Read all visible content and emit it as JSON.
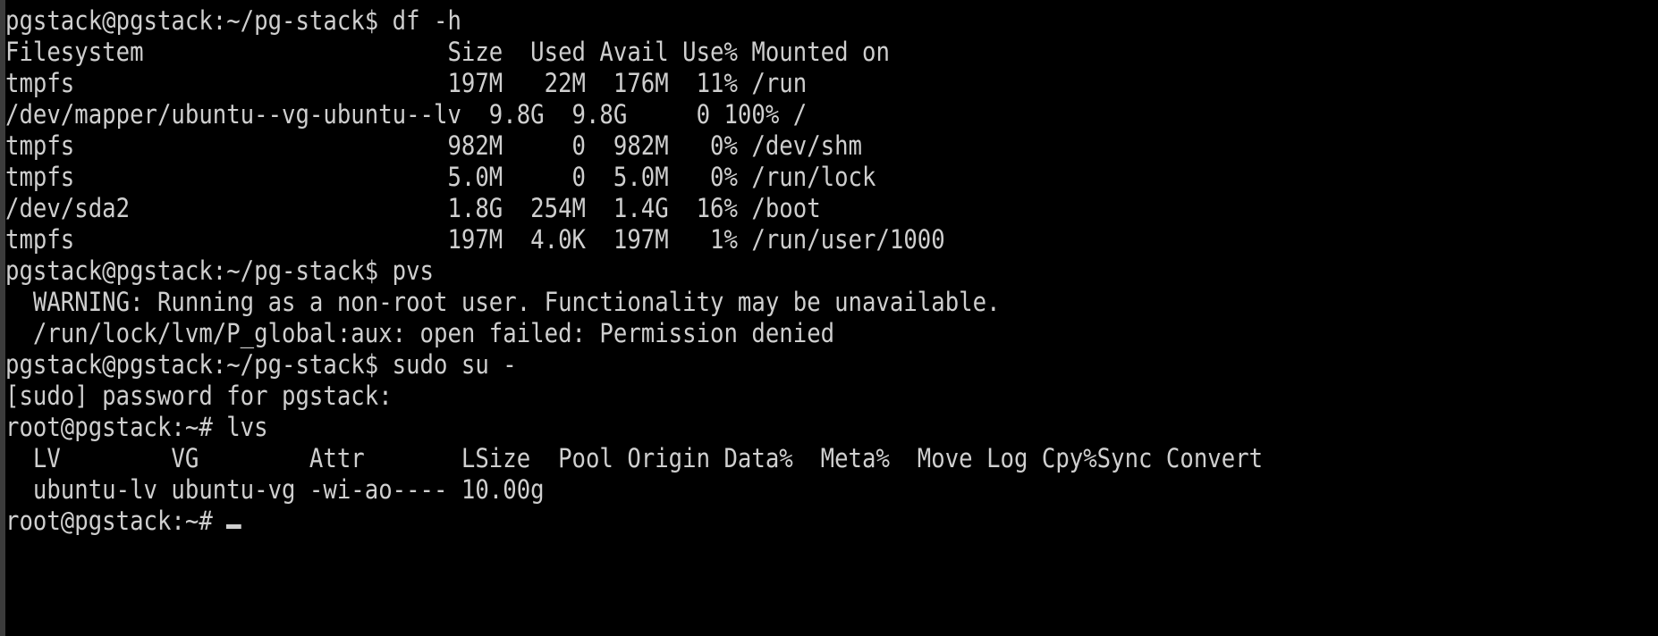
{
  "terminal": {
    "background_color": "#000000",
    "foreground_color": "#cfcfcf",
    "border_color": "#3c3c3c",
    "user_prompt": "pgstack@pgstack:~/pg-stack$ ",
    "root_prompt": "root@pgstack:~# ",
    "cursor": "_"
  },
  "lines": [
    {
      "id": "cmd-df",
      "text": "pgstack@pgstack:~/pg-stack$ df -h"
    },
    {
      "id": "df-header",
      "text": "Filesystem                      Size  Used Avail Use% Mounted on"
    },
    {
      "id": "df-row-tmpfs-run",
      "text": "tmpfs                           197M   22M  176M  11% /run"
    },
    {
      "id": "df-row-ubuntu-lv",
      "text": "/dev/mapper/ubuntu--vg-ubuntu--lv  9.8G  9.8G     0 100% /"
    },
    {
      "id": "df-row-tmpfs-shm",
      "text": "tmpfs                           982M     0  982M   0% /dev/shm"
    },
    {
      "id": "df-row-tmpfs-runlock",
      "text": "tmpfs                           5.0M     0  5.0M   0% /run/lock"
    },
    {
      "id": "df-row-sda2",
      "text": "/dev/sda2                       1.8G  254M  1.4G  16% /boot"
    },
    {
      "id": "df-row-tmpfs-user",
      "text": "tmpfs                           197M  4.0K  197M   1% /run/user/1000"
    },
    {
      "id": "cmd-pvs",
      "text": "pgstack@pgstack:~/pg-stack$ pvs"
    },
    {
      "id": "pvs-warning",
      "text": "  WARNING: Running as a non-root user. Functionality may be unavailable."
    },
    {
      "id": "pvs-error",
      "text": "  /run/lock/lvm/P_global:aux: open failed: Permission denied"
    },
    {
      "id": "cmd-sudo-su",
      "text": "pgstack@pgstack:~/pg-stack$ sudo su -"
    },
    {
      "id": "sudo-password-prompt",
      "text": "[sudo] password for pgstack:"
    },
    {
      "id": "cmd-lvs",
      "text": "root@pgstack:~# lvs"
    },
    {
      "id": "lvs-header",
      "text": "  LV        VG        Attr       LSize  Pool Origin Data%  Meta%  Move Log Cpy%Sync Convert"
    },
    {
      "id": "lvs-row-ubuntu-lv",
      "text": "  ubuntu-lv ubuntu-vg -wi-ao---- 10.00g"
    },
    {
      "id": "prompt-final",
      "text": "root@pgstack:~# "
    }
  ],
  "df_table": {
    "command": "df -h",
    "columns": [
      "Filesystem",
      "Size",
      "Used",
      "Avail",
      "Use%",
      "Mounted on"
    ],
    "rows": [
      {
        "filesystem": "tmpfs",
        "size": "197M",
        "used": "22M",
        "avail": "176M",
        "use_pct": "11%",
        "mounted_on": "/run"
      },
      {
        "filesystem": "/dev/mapper/ubuntu--vg-ubuntu--lv",
        "size": "9.8G",
        "used": "9.8G",
        "avail": "0",
        "use_pct": "100%",
        "mounted_on": "/"
      },
      {
        "filesystem": "tmpfs",
        "size": "982M",
        "used": "0",
        "avail": "982M",
        "use_pct": "0%",
        "mounted_on": "/dev/shm"
      },
      {
        "filesystem": "tmpfs",
        "size": "5.0M",
        "used": "0",
        "avail": "5.0M",
        "use_pct": "0%",
        "mounted_on": "/run/lock"
      },
      {
        "filesystem": "/dev/sda2",
        "size": "1.8G",
        "used": "254M",
        "avail": "1.4G",
        "use_pct": "16%",
        "mounted_on": "/boot"
      },
      {
        "filesystem": "tmpfs",
        "size": "197M",
        "used": "4.0K",
        "avail": "197M",
        "use_pct": "1%",
        "mounted_on": "/run/user/1000"
      }
    ]
  },
  "lvs_table": {
    "command": "lvs",
    "columns": [
      "LV",
      "VG",
      "Attr",
      "LSize",
      "Pool",
      "Origin",
      "Data%",
      "Meta%",
      "Move",
      "Log",
      "Cpy%Sync",
      "Convert"
    ],
    "rows": [
      {
        "lv": "ubuntu-lv",
        "vg": "ubuntu-vg",
        "attr": "-wi-ao----",
        "lsize": "10.00g",
        "pool": "",
        "origin": "",
        "data_pct": "",
        "meta_pct": "",
        "move": "",
        "log": "",
        "cpy_sync": "",
        "convert": ""
      }
    ]
  },
  "pvs_output": {
    "command": "pvs",
    "warning": "WARNING: Running as a non-root user. Functionality may be unavailable.",
    "error": "/run/lock/lvm/P_global:aux: open failed: Permission denied"
  }
}
